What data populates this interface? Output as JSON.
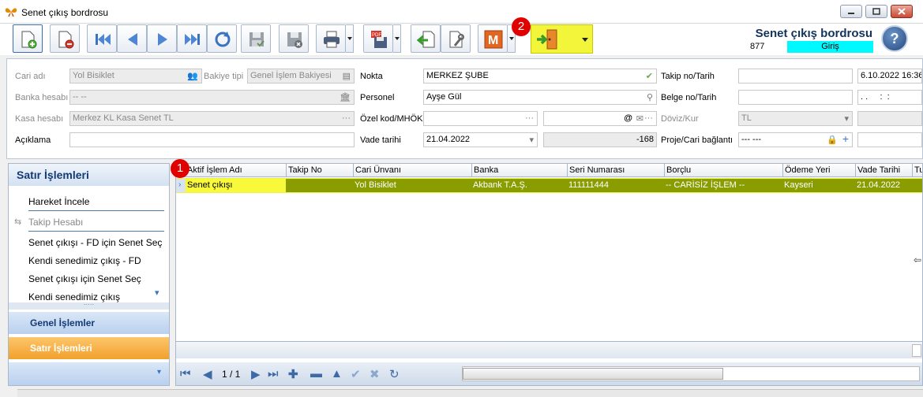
{
  "window": {
    "title": "Senet çıkış bordrosu"
  },
  "header": {
    "title": "Senet çıkış bordrosu",
    "doc_no": "877",
    "state": "Giriş",
    "help": "?"
  },
  "badges": {
    "one": "1",
    "two": "2"
  },
  "form": {
    "cari_adi": {
      "label": "Cari adı",
      "value": "Yol Bisiklet"
    },
    "bakiye_tipi": {
      "label": "Bakiye tipi",
      "value": "Genel İşlem Bakiyesi"
    },
    "banka_hesabi": {
      "label": "Banka hesabı",
      "value": "-- --"
    },
    "kasa_hesabi": {
      "label": "Kasa hesabı",
      "value": "Merkez KL Kasa Senet TL"
    },
    "aciklama": {
      "label": "Açıklama",
      "value": ""
    },
    "nokta": {
      "label": "Nokta",
      "value": "MERKEZ ŞUBE"
    },
    "personel": {
      "label": "Personel",
      "value": "Ayşe Gül"
    },
    "ozel_kod": {
      "label": "Özel kod/MHÖK",
      "value": ""
    },
    "vade_tarihi": {
      "label": "Vade tarihi",
      "value": "21.04.2022",
      "days": "-168"
    },
    "takip_no": {
      "label": "Takip no/Tarih",
      "value": "",
      "date": "6.10.2022 16:36"
    },
    "belge_no": {
      "label": "Belge no/Tarih",
      "value": "",
      "date": ". .     :  :"
    },
    "doviz_kur": {
      "label": "Döviz/Kur",
      "value": "TL"
    },
    "proje": {
      "label": "Proje/Cari bağlantı",
      "value": "--- ---"
    },
    "email_at": "@"
  },
  "left_panel": {
    "title": "Satır İşlemleri",
    "items": [
      "Hareket İncele",
      "Takip Hesabı",
      "Senet çıkışı - FD için Senet Seç",
      "Kendi senedimiz çıkış - FD",
      "Senet çıkışı için Senet Seç",
      "Kendi senedimiz çıkış"
    ],
    "groups": [
      "Genel İşlemler",
      "Satır İşlemleri"
    ]
  },
  "grid": {
    "columns": [
      "Aktif İşlem Adı",
      "Takip No",
      "Cari Ünvanı",
      "Banka",
      "Seri Numarası",
      "Borçlu",
      "Ödeme Yeri",
      "Vade Tarihi",
      "Tu"
    ],
    "row": [
      "Senet çıkışı",
      "",
      "Yol Bisiklet",
      "Akbank T.A.Ş.",
      "111111444",
      "-- CARİSİZ İŞLEM --",
      "Kayseri",
      "21.04.2022",
      ""
    ]
  },
  "navigator": {
    "page": "1 / 1"
  },
  "colors": {
    "highlight": "#f2f53a",
    "row": "#8a9d00",
    "accent": "#143a75",
    "state_bg": "#00f8ff"
  }
}
